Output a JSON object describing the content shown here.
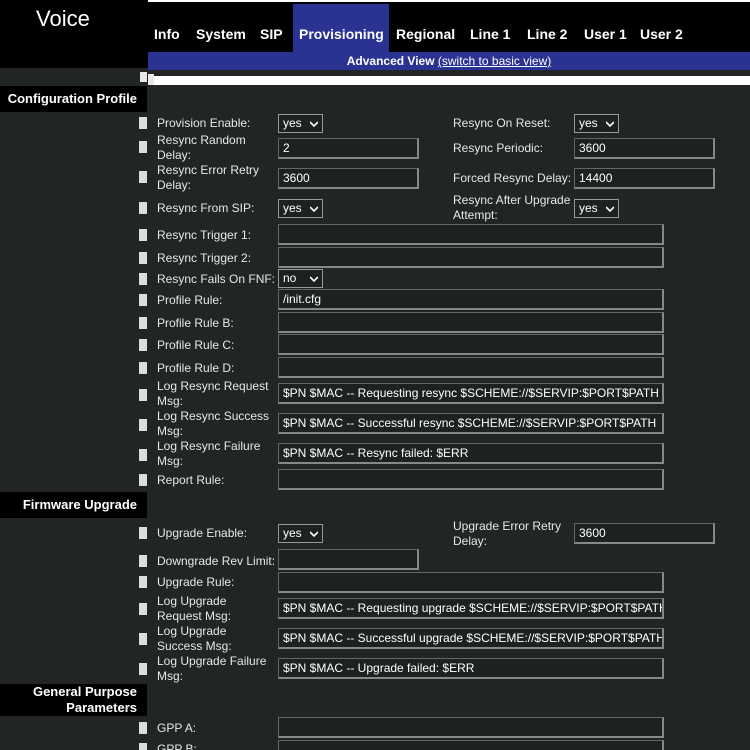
{
  "brand": "Voice",
  "tabs": [
    {
      "label": "Info",
      "active": false
    },
    {
      "label": "System",
      "active": false
    },
    {
      "label": "SIP",
      "active": false
    },
    {
      "label": "Provisioning",
      "active": true
    },
    {
      "label": "Regional",
      "active": false
    },
    {
      "label": "Line 1",
      "active": false
    },
    {
      "label": "Line 2",
      "active": false
    },
    {
      "label": "User 1",
      "active": false
    },
    {
      "label": "User 2",
      "active": false
    }
  ],
  "view": {
    "current": "Advanced View",
    "switch_link": "(switch to basic view)"
  },
  "sections": {
    "config_profile": "Configuration Profile",
    "firmware_upgrade": "Firmware Upgrade",
    "gpp_line1": "General Purpose",
    "gpp_line2": "Parameters"
  },
  "config": {
    "provision_enable": {
      "label": "Provision Enable:",
      "value": "yes"
    },
    "resync_on_reset": {
      "label": "Resync On Reset:",
      "value": "yes"
    },
    "resync_random_delay": {
      "label1": "Resync Random",
      "label2": "Delay:",
      "value": "2"
    },
    "resync_periodic": {
      "label": "Resync Periodic:",
      "value": "3600"
    },
    "resync_error_retry": {
      "label1": "Resync Error Retry",
      "label2": "Delay:",
      "value": "3600"
    },
    "forced_resync_delay": {
      "label": "Forced Resync Delay:",
      "value": "14400"
    },
    "resync_from_sip": {
      "label": "Resync From SIP:",
      "value": "yes"
    },
    "resync_after_upgrade": {
      "label1": "Resync After Upgrade",
      "label2": "Attempt:",
      "value": "yes"
    },
    "resync_trigger_1": {
      "label": "Resync Trigger 1:",
      "value": ""
    },
    "resync_trigger_2": {
      "label": "Resync Trigger 2:",
      "value": ""
    },
    "resync_fails_fnf": {
      "label": "Resync Fails On FNF:",
      "value": "no"
    },
    "profile_rule": {
      "label": "Profile Rule:",
      "value": "/init.cfg"
    },
    "profile_rule_b": {
      "label": "Profile Rule B:",
      "value": ""
    },
    "profile_rule_c": {
      "label": "Profile Rule C:",
      "value": ""
    },
    "profile_rule_d": {
      "label": "Profile Rule D:",
      "value": ""
    },
    "log_resync_request": {
      "label1": "Log Resync Request",
      "label2": "Msg:",
      "value": "$PN $MAC -- Requesting resync $SCHEME://$SERVIP:$PORT$PATH"
    },
    "log_resync_success": {
      "label1": "Log Resync Success",
      "label2": "Msg:",
      "value": "$PN $MAC -- Successful resync $SCHEME://$SERVIP:$PORT$PATH"
    },
    "log_resync_failure": {
      "label1": "Log Resync Failure",
      "label2": "Msg:",
      "value": "$PN $MAC -- Resync failed: $ERR"
    },
    "report_rule": {
      "label": "Report Rule:",
      "value": ""
    }
  },
  "firmware": {
    "upgrade_enable": {
      "label": "Upgrade Enable:",
      "value": "yes"
    },
    "upgrade_error_retry": {
      "label1": "Upgrade Error Retry",
      "label2": "Delay:",
      "value": "3600"
    },
    "downgrade_rev_limit": {
      "label": "Downgrade Rev Limit:",
      "value": ""
    },
    "upgrade_rule": {
      "label": "Upgrade Rule:",
      "value": ""
    },
    "log_upgrade_request": {
      "label1": "Log Upgrade",
      "label2": "Request Msg:",
      "value": "$PN $MAC -- Requesting upgrade $SCHEME://$SERVIP:$PORT$PATH"
    },
    "log_upgrade_success": {
      "label1": "Log Upgrade",
      "label2": "Success Msg:",
      "value": "$PN $MAC -- Successful upgrade $SCHEME://$SERVIP:$PORT$PATH"
    },
    "log_upgrade_failure": {
      "label1": "Log Upgrade Failure",
      "label2": "Msg:",
      "value": "$PN $MAC -- Upgrade failed: $ERR"
    }
  },
  "gpp": {
    "gpp_a": {
      "label": "GPP A:",
      "value": ""
    },
    "gpp_b": {
      "label": "GPP B:",
      "value": ""
    }
  },
  "icons": {
    "dropdown": "chevron-down-icon"
  }
}
